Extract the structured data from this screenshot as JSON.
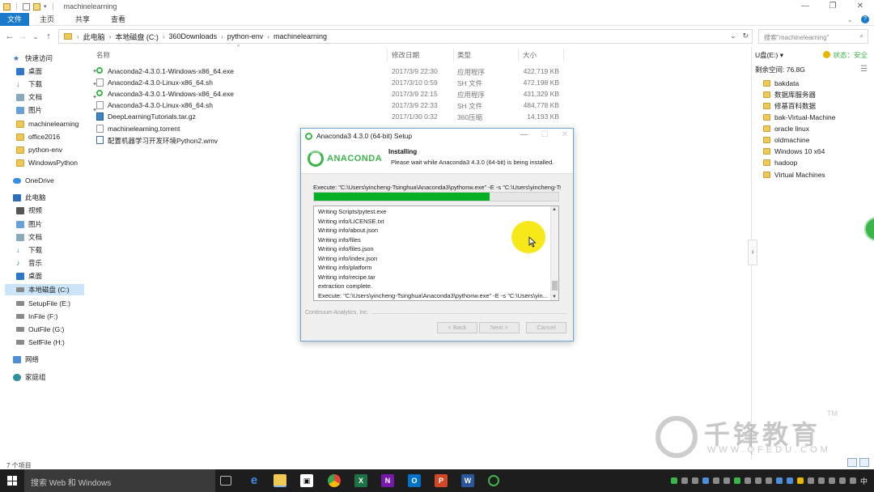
{
  "window": {
    "title": "machinelearning"
  },
  "ribbon": {
    "tabs": [
      "文件",
      "主页",
      "共享",
      "查看"
    ]
  },
  "address": {
    "crumbs": [
      "此电脑",
      "本地磁盘 (C:)",
      "360Downloads",
      "python-env",
      "machinelearning"
    ],
    "search_placeholder": "搜索\"machinelearning\""
  },
  "nav": {
    "quick_access": "快速访问",
    "pinned": [
      "桌面",
      "下载",
      "文档",
      "图片"
    ],
    "recent": [
      "machinelearning",
      "office2016",
      "python-env",
      "WindowsPython"
    ],
    "onedrive": "OneDrive",
    "this_pc": "此电脑",
    "pc_items": [
      "视频",
      "图片",
      "文档",
      "下载",
      "音乐",
      "桌面"
    ],
    "drives": [
      "本地磁盘 (C:)",
      "SetupFile (E:)",
      "InFile (F:)",
      "OutFile (G:)",
      "SelfFile (H:)"
    ],
    "network": "网络",
    "homegroup": "家庭组"
  },
  "file_list": {
    "columns": [
      "名称",
      "修改日期",
      "类型",
      "大小"
    ],
    "rows": [
      {
        "icon": "exe",
        "name": "Anaconda2-4.3.0.1-Windows-x86_64.exe",
        "date": "2017/3/9 22:30",
        "type": "应用程序",
        "size": "422,719 KB"
      },
      {
        "icon": "doc",
        "name": "Anaconda2-4.3.0-Linux-x86_64.sh",
        "date": "2017/3/10 0:59",
        "type": "SH 文件",
        "size": "472,198 KB"
      },
      {
        "icon": "exe",
        "name": "Anaconda3-4.3.0.1-Windows-x86_64.exe",
        "date": "2017/3/9 22:15",
        "type": "应用程序",
        "size": "431,329 KB"
      },
      {
        "icon": "doc",
        "name": "Anaconda3-4.3.0-Linux-x86_64.sh",
        "date": "2017/3/9 22:33",
        "type": "SH 文件",
        "size": "484,778 KB"
      },
      {
        "icon": "gz",
        "name": "DeepLearningTutorials.tar.gz",
        "date": "2017/1/30 0:32",
        "type": "360压缩",
        "size": "14,193 KB"
      },
      {
        "icon": "doc",
        "name": "machinelearning.torrent",
        "date": "",
        "type": "",
        "size": ""
      },
      {
        "icon": "wmv",
        "name": "配置机器学习开发环境Python2.wmv",
        "date": "",
        "type": "",
        "size": ""
      }
    ],
    "status": "7 个项目"
  },
  "usb": {
    "title": "U盘(E:) ▾",
    "status": "状态：安全",
    "free": "剩余空间: 76.8G",
    "folders": [
      "bakdata",
      "数据库服务器",
      "修基百科数据",
      "bak-Virtual-Machine",
      "oracle linux",
      "oldmachine",
      "Windows 10 x64",
      "hadoop",
      "Virtual Machines"
    ]
  },
  "installer": {
    "title": "Anaconda3 4.3.0 (64-bit) Setup",
    "brand": "ANACONDA",
    "heading": "Installing",
    "subheading": "Please wait while Anaconda3 4.3.0 (64-bit) is being installed.",
    "execute": "Execute: \"C:\\Users\\yincheng-Tsinghua\\Anaconda3\\pythonw.exe\" -E -s \"C:\\Users\\yincheng-Ts",
    "progress": 0.72,
    "log": [
      "Writing Scripts/pytest.exe",
      "Writing info/LICENSE.txt",
      "Writing info/about.json",
      "Writing info/files",
      "Writing info/files.json",
      "Writing info/index.json",
      "Writing info/platform",
      "Writing info/recipe.tar",
      "extraction complete.",
      "Execute: \"C:\\Users\\yincheng-Tsinghua\\Anaconda3\\pythonw.exe\" -E -s \"C:\\Users\\yin..."
    ],
    "branding": "Continuum Analytics, Inc.",
    "buttons": {
      "back": "< Back",
      "next": "Next >",
      "cancel": "Cancel"
    }
  },
  "watermark": {
    "main": "千锋教育",
    "sub": "WWW.QFEDU.COM",
    "tm": "TM"
  },
  "taskbar": {
    "search": "搜索 Web 和 Windows",
    "time_lang": "中"
  },
  "colors": {
    "accent": "#1979ca",
    "progress": "#06b025",
    "anaconda": "#3bb44a"
  }
}
